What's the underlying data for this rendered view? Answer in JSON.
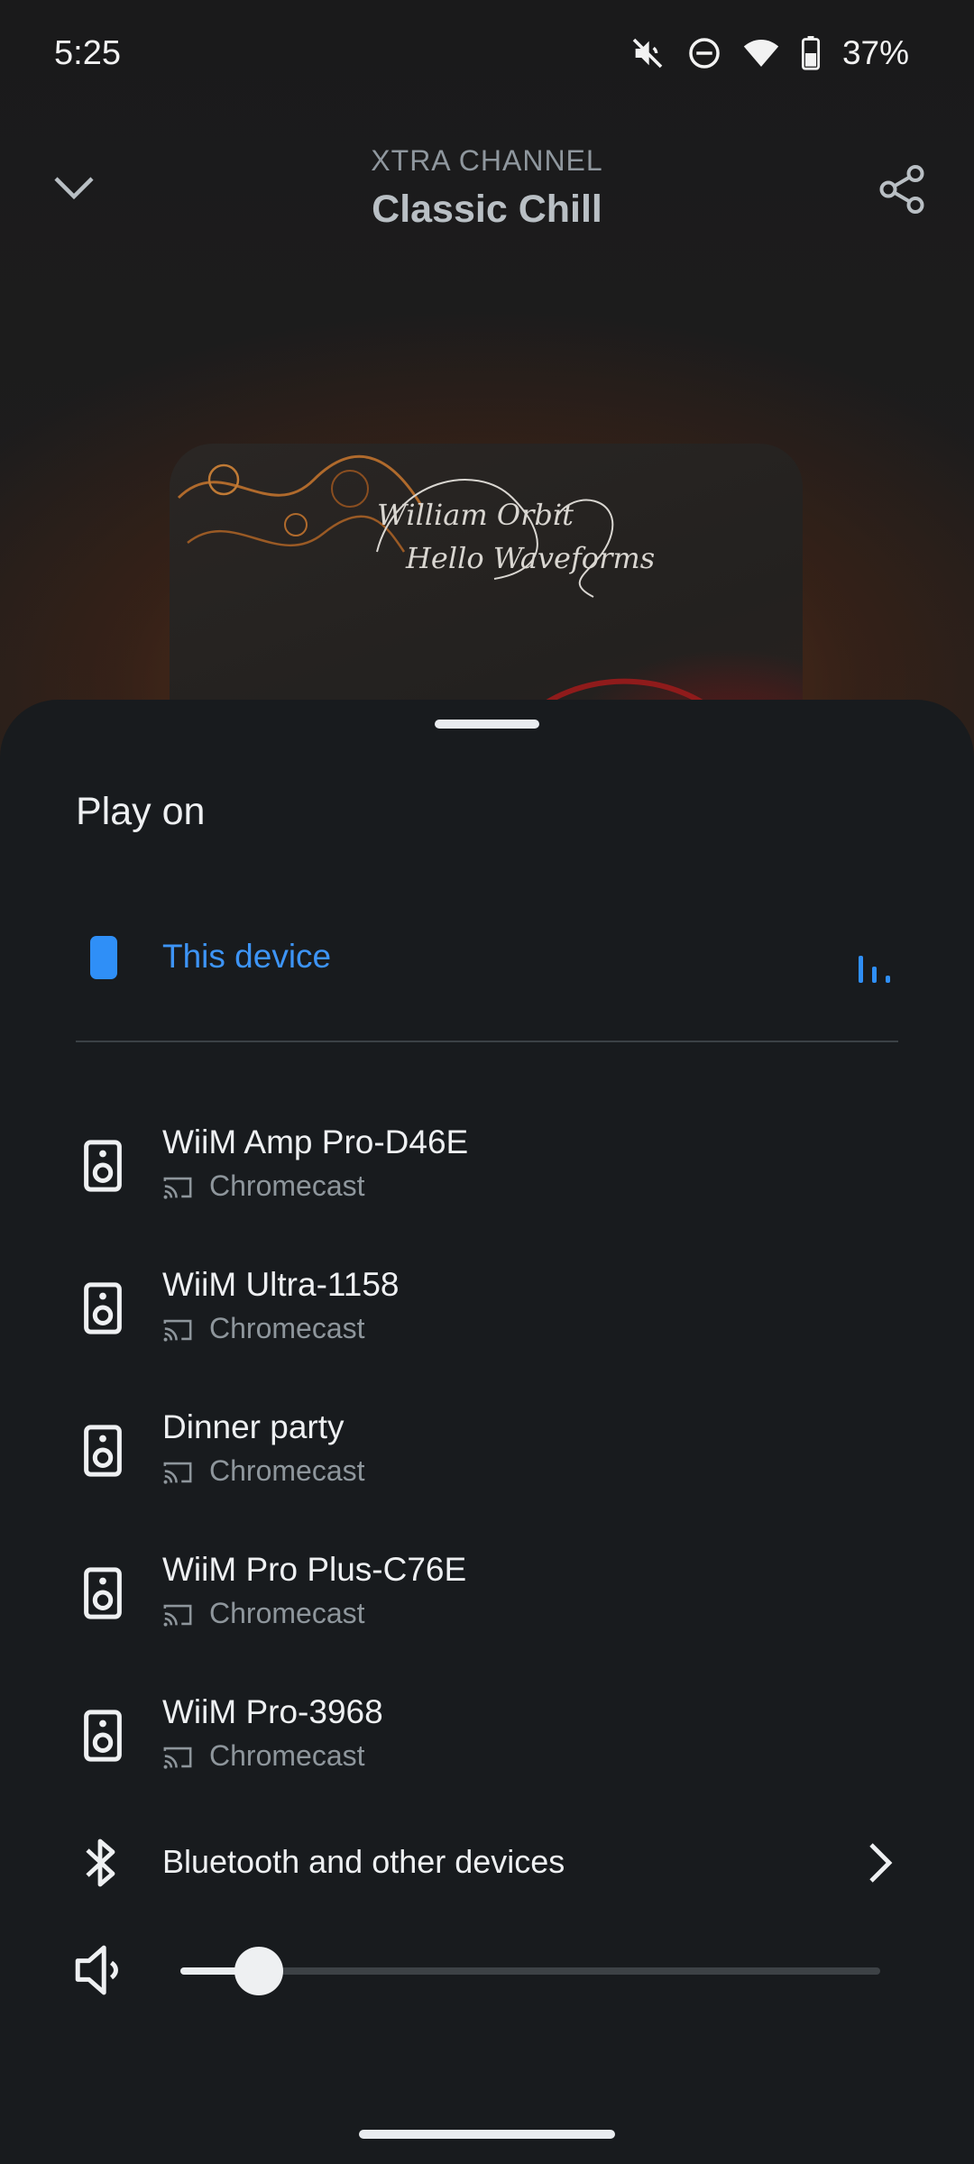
{
  "status_bar": {
    "time": "5:25",
    "battery": "37%",
    "icons": [
      "mute-icon",
      "dnd-icon",
      "wifi-icon",
      "battery-icon"
    ]
  },
  "header": {
    "subtitle": "XTRA CHANNEL",
    "title": "Classic Chill"
  },
  "artwork": {
    "line1": "William Orbit",
    "line2": "Hello Waveforms"
  },
  "sheet": {
    "title": "Play on",
    "current_device": {
      "label": "This device",
      "icon": "phone-icon",
      "accent": "#2f8ff7"
    },
    "devices": [
      {
        "name": "WiiM Amp Pro-D46E",
        "type": "Chromecast"
      },
      {
        "name": "WiiM Ultra-1158",
        "type": "Chromecast"
      },
      {
        "name": "Dinner party",
        "type": "Chromecast"
      },
      {
        "name": "WiiM Pro Plus-C76E",
        "type": "Chromecast"
      },
      {
        "name": "WiiM Pro-3968",
        "type": "Chromecast"
      }
    ],
    "bluetooth": {
      "label": "Bluetooth and other devices"
    },
    "volume": {
      "level": 0.06
    }
  }
}
